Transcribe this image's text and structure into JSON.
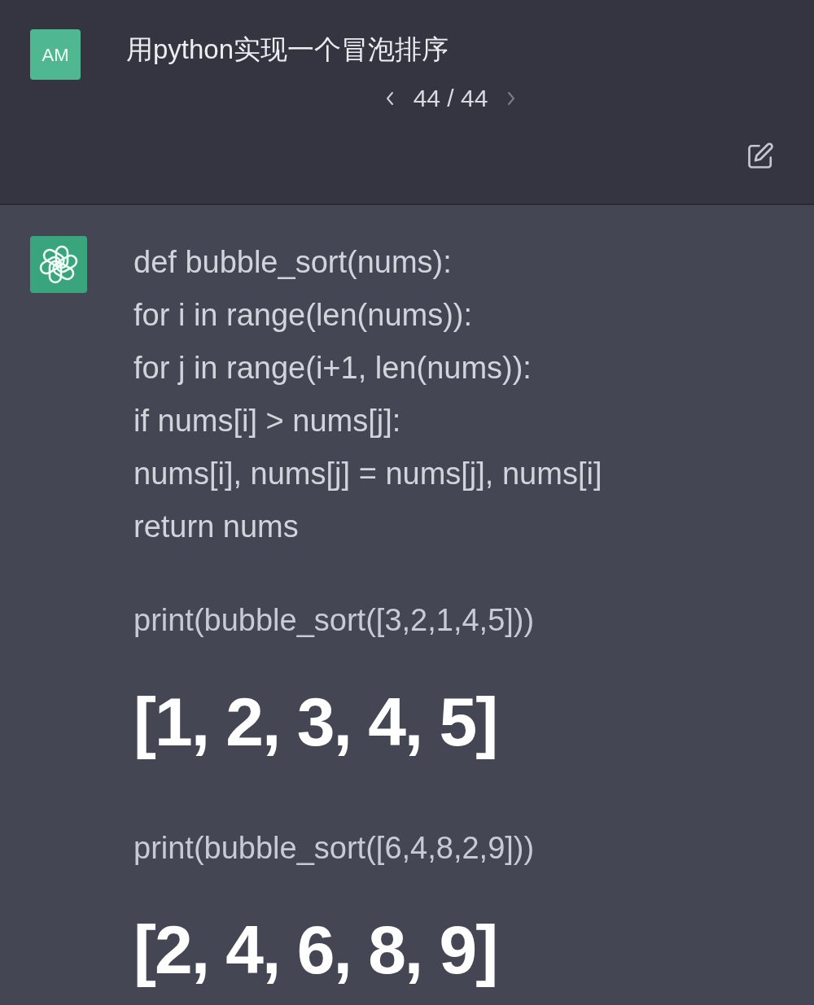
{
  "user_message": {
    "avatar": "AM",
    "text": "用python实现一个冒泡排序",
    "pager": {
      "previous": {
        "disabled": false
      },
      "count": "44 / 44",
      "next": {
        "disabled": true
      }
    }
  },
  "assistant_message": {
    "blocks": [
      {
        "kind": "code",
        "lines": [
          "def bubble_sort(nums):",
          "for i in range(len(nums)):",
          "for j in range(i+1, len(nums)):",
          "if nums[i] > nums[j]:",
          "nums[i], nums[j] = nums[j], nums[i]",
          "return nums"
        ]
      },
      {
        "kind": "call",
        "lines": [
          "print(bubble_sort([3,2,1,4,5]))"
        ]
      },
      {
        "kind": "output",
        "lines": [
          "[1, 2, 3, 4, 5]"
        ]
      },
      {
        "kind": "call",
        "lines": [
          "print(bubble_sort([6,4,8,2,9]))"
        ]
      },
      {
        "kind": "output",
        "lines": [
          "[2, 4, 6, 8, 9]"
        ]
      }
    ]
  }
}
